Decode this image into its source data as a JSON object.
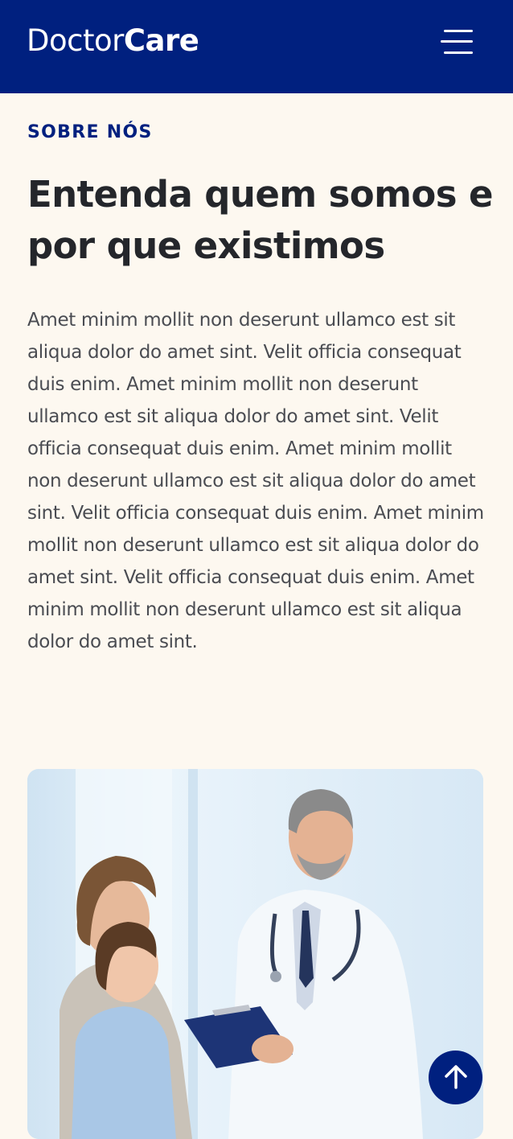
{
  "header": {
    "logo_part_1": "Doctor",
    "logo_part_2": "Care",
    "menu_icon": "hamburger-menu-icon",
    "background_color": "#00207f"
  },
  "about": {
    "label": "SOBRE NÓS",
    "title": "Entenda quem somos e por que existimos",
    "paragraph": "Amet minim mollit non deserunt ullamco est sit aliqua dolor do amet sint. Velit officia consequat duis enim. Amet minim mollit non deserunt ullamco est sit aliqua dolor do amet sint. Velit officia consequat duis enim. Amet minim mollit non deserunt ullamco est sit aliqua dolor do amet sint. Velit officia consequat duis enim. Amet minim mollit non deserunt ullamco est sit aliqua dolor do amet sint. Velit officia consequat duis enim. Amet minim mollit non deserunt ullamco est sit aliqua dolor do amet sint."
  },
  "back_to_top": {
    "icon": "arrow-up-icon"
  },
  "colors": {
    "primary": "#00207f",
    "page_background": "#fdf8f0",
    "heading_text": "#24262b",
    "body_text": "#4a4c52"
  }
}
